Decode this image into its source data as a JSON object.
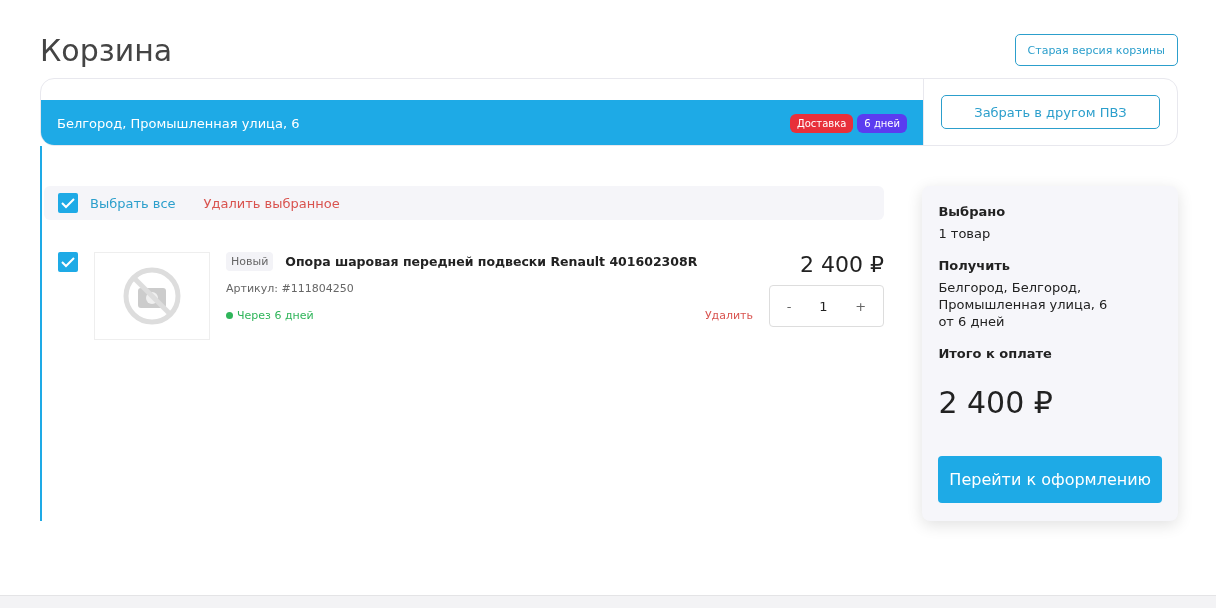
{
  "page_title": "Корзина",
  "old_version_button": "Старая версия корзины",
  "delivery": {
    "address": "Белгород, Промышленная улица, 6",
    "badges": [
      {
        "label": "Доставка",
        "color": "#e8303a"
      },
      {
        "label": "6 дней",
        "color": "#5b3cf0"
      }
    ],
    "change_point_button": "Забрать в другом ПВЗ"
  },
  "toolbar": {
    "select_all": {
      "label": "Выбрать все",
      "checked": true
    },
    "delete_selected": "Удалить выбранное"
  },
  "items": [
    {
      "checked": true,
      "tag": "Новый",
      "name": "Опора шаровая передней подвески Renault 401602308R",
      "article": "Артикул: #111804250",
      "delivery_eta": "Через 6 дней",
      "delete": "Удалить",
      "price": "2 400 ₽",
      "minus": "-",
      "quantity": "1",
      "plus": "+"
    }
  ],
  "summary": {
    "sections": [
      {
        "heading": "Выбрано",
        "lines": [
          "1 товар"
        ]
      },
      {
        "heading": "Получить",
        "lines": [
          "Белгород, Белгород,",
          "Промышленная улица, 6",
          "от 6 дней"
        ]
      },
      {
        "heading": "Итого к оплате"
      }
    ],
    "total": "2 400 ₽",
    "checkout_button": "Перейти к оформлению"
  }
}
